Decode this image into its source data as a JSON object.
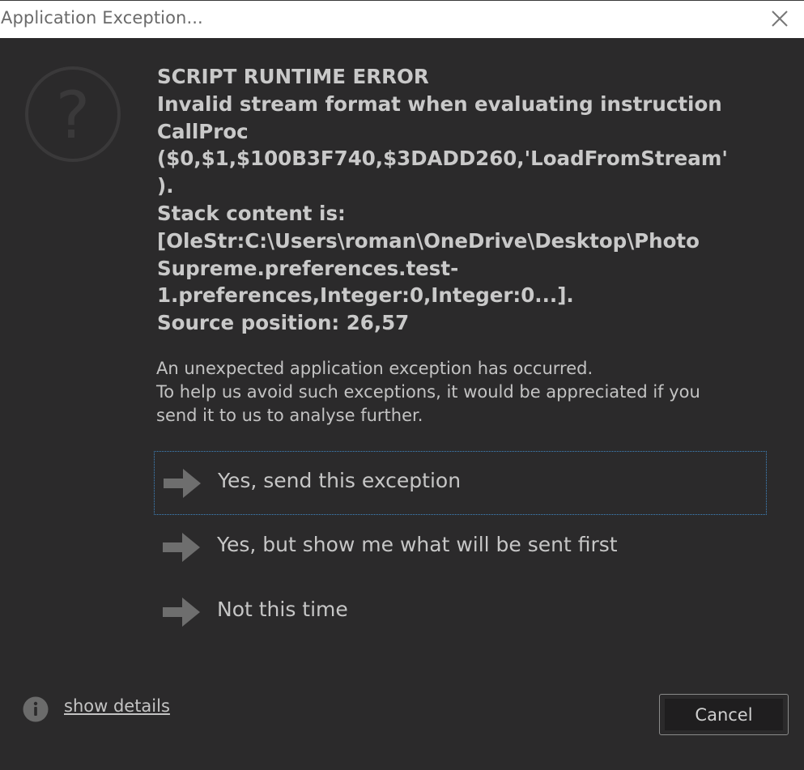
{
  "window": {
    "title": "Application Exception...",
    "close_icon": "close-icon"
  },
  "error": {
    "heading": "SCRIPT RUNTIME ERROR",
    "lines": [
      "Invalid stream format when evaluating instruction",
      "CallProc",
      "($0,$1,$100B3F740,$3DADD260,'LoadFromStream'",
      ").",
      "Stack content is:",
      "[OleStr:C:\\Users\\roman\\OneDrive\\Desktop\\Photo",
      "Supreme.preferences.test-",
      "1.preferences,Integer:0,Integer:0...].",
      "Source position: 26,57"
    ]
  },
  "description": {
    "line1": "An unexpected application exception has occurred.",
    "line2": "To help us avoid such exceptions, it would be appreciated if you",
    "line3": "send it to us to analyse further."
  },
  "options": [
    {
      "label": "Yes, send this exception",
      "icon": "arrow-right-icon"
    },
    {
      "label": "Yes, but show me what will be sent first",
      "icon": "arrow-right-icon"
    },
    {
      "label": "Not this time",
      "icon": "arrow-right-icon"
    }
  ],
  "footer": {
    "details_link": "show details",
    "info_icon": "info-icon",
    "cancel_label": "Cancel"
  },
  "colors": {
    "background": "#2b2a2b",
    "titlebar": "#ffffff",
    "text": "#c9c9c9",
    "focus_outline": "#3f86c2"
  }
}
